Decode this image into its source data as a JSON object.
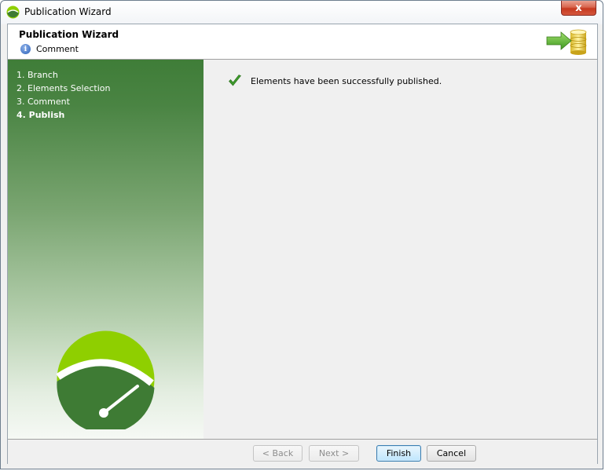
{
  "window": {
    "title": "Publication Wizard",
    "close_label": "x"
  },
  "header": {
    "title": "Publication Wizard",
    "subtitle": "Comment",
    "info_icon": "info-icon",
    "graphic_icon": "publish-database-icon"
  },
  "steps": [
    {
      "label": "1. Branch",
      "current": false
    },
    {
      "label": "2. Elements Selection",
      "current": false
    },
    {
      "label": "3. Comment",
      "current": false
    },
    {
      "label": "4. Publish",
      "current": true
    }
  ],
  "content": {
    "status_icon": "check-icon",
    "status_text": "Elements have been successfully published."
  },
  "buttons": {
    "back": "< Back",
    "next": "Next >",
    "finish": "Finish",
    "cancel": "Cancel"
  },
  "colors": {
    "sidebar_green": "#3f7d38",
    "logo_lime": "#8fcf00",
    "logo_dark": "#3e7b34",
    "check_green": "#3c9a2b"
  }
}
